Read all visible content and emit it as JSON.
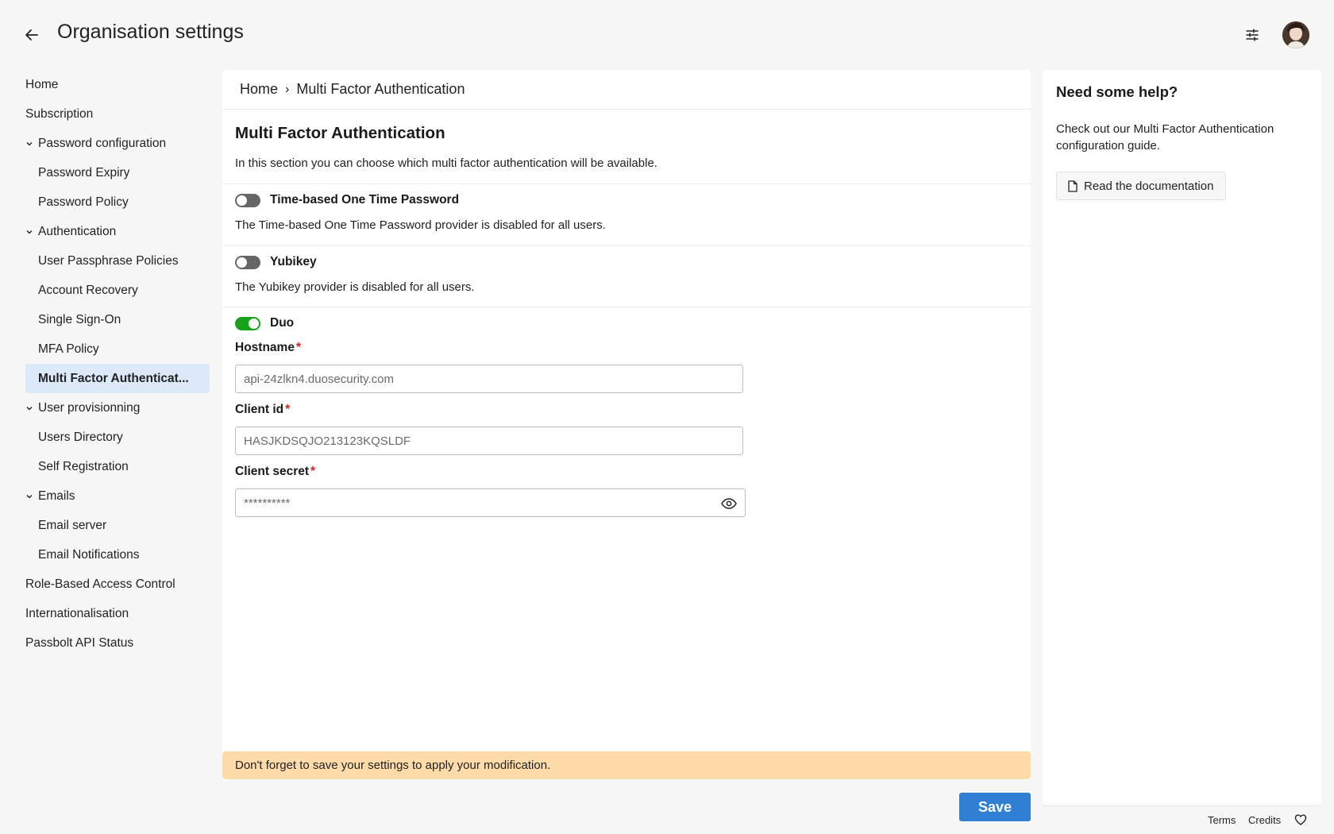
{
  "header": {
    "title": "Organisation settings",
    "back_icon": "arrow-left-icon",
    "filter_icon": "sliders-icon"
  },
  "sidebar": {
    "items": [
      {
        "label": "Home"
      },
      {
        "label": "Subscription"
      },
      {
        "label": "Password configuration"
      },
      {
        "label": "Password Expiry"
      },
      {
        "label": "Password Policy"
      },
      {
        "label": "Authentication"
      },
      {
        "label": "User Passphrase Policies"
      },
      {
        "label": "Account Recovery"
      },
      {
        "label": "Single Sign-On"
      },
      {
        "label": "MFA Policy"
      },
      {
        "label": "Multi Factor Authenticat..."
      },
      {
        "label": "User provisionning"
      },
      {
        "label": "Users Directory"
      },
      {
        "label": "Self Registration"
      },
      {
        "label": "Emails"
      },
      {
        "label": "Email server"
      },
      {
        "label": "Email Notifications"
      },
      {
        "label": "Role-Based Access Control"
      },
      {
        "label": "Internationalisation"
      },
      {
        "label": "Passbolt API Status"
      }
    ]
  },
  "breadcrumb": {
    "home": "Home",
    "separator": "›",
    "current": "Multi Factor Authentication"
  },
  "main": {
    "title": "Multi Factor Authentication",
    "description": "In this section you can choose which multi factor authentication will be available."
  },
  "providers": {
    "totp": {
      "name": "Time-based One Time Password",
      "description": "The Time-based One Time Password provider is disabled for all users.",
      "enabled": false
    },
    "yubikey": {
      "name": "Yubikey",
      "description": "The Yubikey provider is disabled for all users.",
      "enabled": false
    },
    "duo": {
      "name": "Duo",
      "enabled": true,
      "hostname_label": "Hostname",
      "hostname_value": "api-24zlkn4.duosecurity.com",
      "client_id_label": "Client id",
      "client_id_value": "HASJKDSQJO213123KQSLDF",
      "client_secret_label": "Client secret",
      "client_secret_value": "**********",
      "required_mark": "*"
    }
  },
  "warning": "Don't forget to save your settings to apply your modification.",
  "save_label": "Save",
  "help": {
    "title": "Need some help?",
    "text": "Check out our Multi Factor Authentication configuration guide.",
    "doc_button": "Read the documentation"
  },
  "footer": {
    "terms": "Terms",
    "credits": "Credits"
  },
  "colors": {
    "accent": "#2f7fd3",
    "toggle_on": "#16a21a",
    "warning_bg": "#fedba8",
    "active_nav_bg": "#dbe9f8",
    "required": "#d0241c"
  }
}
